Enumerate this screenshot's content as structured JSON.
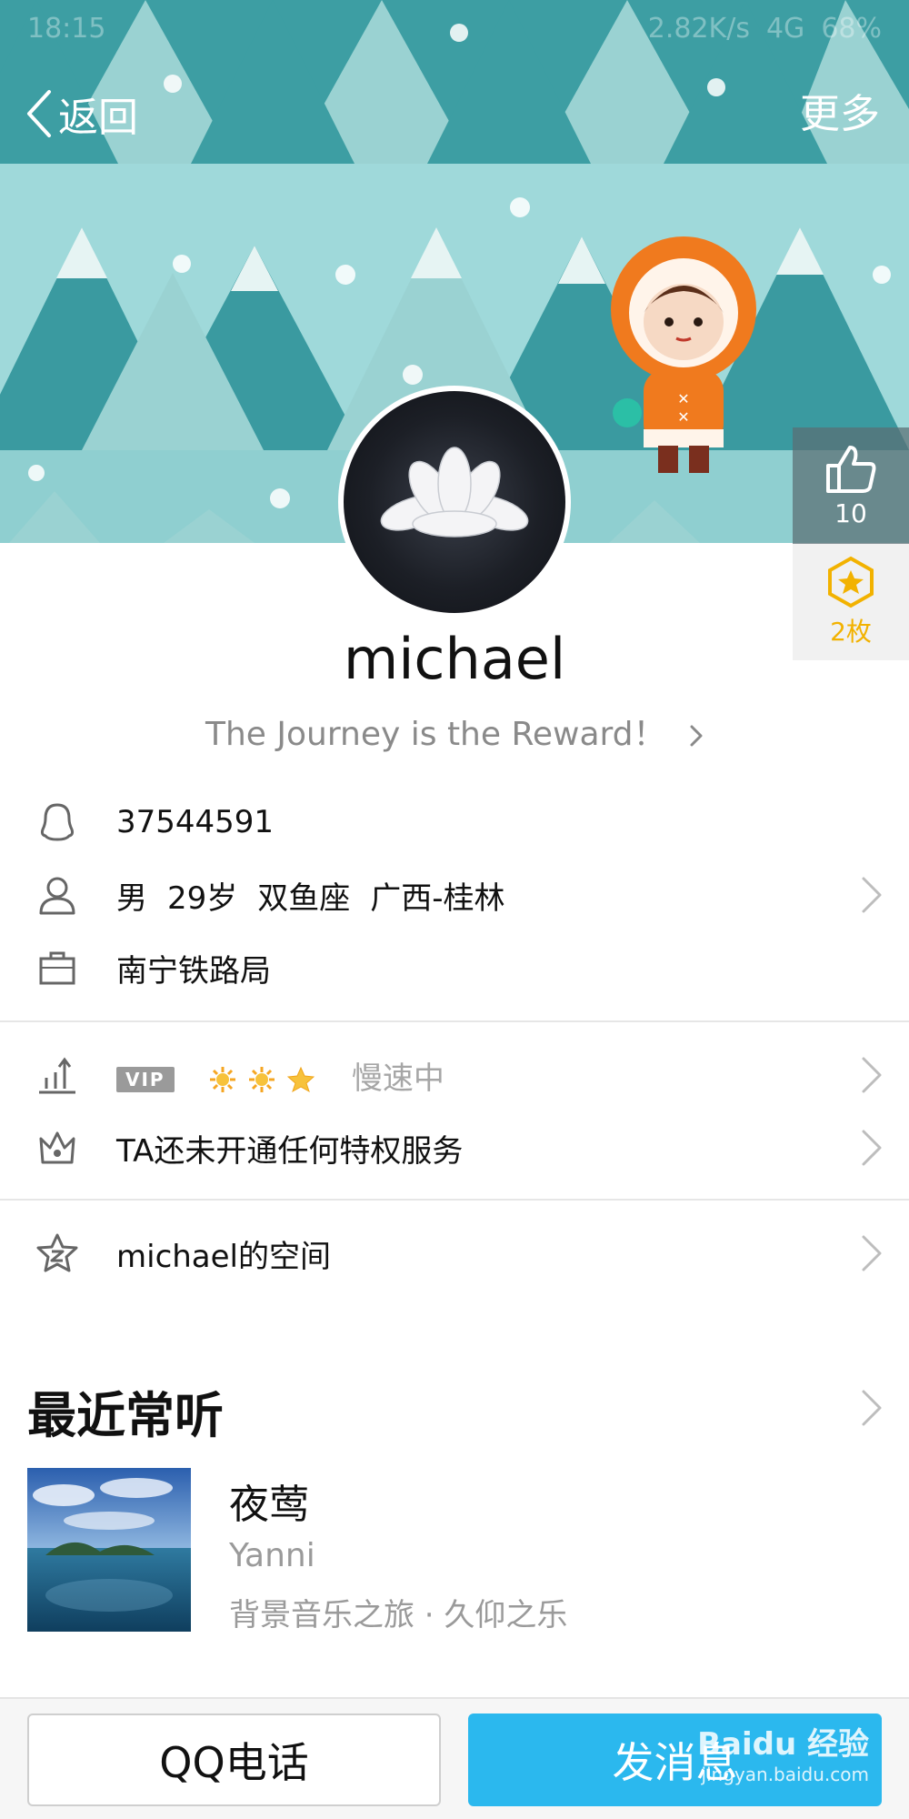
{
  "status_bar": {
    "time": "18:15",
    "speed": "2.82K/s",
    "network": "4G",
    "battery": "68%"
  },
  "nav": {
    "back_label": "返回",
    "more_label": "更多"
  },
  "likes": {
    "count": "10"
  },
  "badges": {
    "count": "2枚"
  },
  "profile": {
    "name": "michael",
    "signature": "The Journey is the Reward！"
  },
  "info": {
    "qq_number": "37544591",
    "gender": "男",
    "age": "29岁",
    "zodiac": "双鱼座",
    "location": "广西-桂林",
    "company": "南宁铁路局"
  },
  "level": {
    "vip_tag": "VIP",
    "speed_text": "慢速中"
  },
  "privilege": {
    "text": "TA还未开通任何特权服务"
  },
  "qzone": {
    "label": "michael的空间"
  },
  "recent": {
    "title": "最近常听",
    "song": {
      "title": "夜莺",
      "artist": "Yanni",
      "album": "背景音乐之旅 · 久仰之乐"
    }
  },
  "actions": {
    "call_label": "QQ电话",
    "message_label": "发消息"
  },
  "watermark": {
    "brand": "Baidu 经验",
    "url": "jingyan.baidu.com"
  },
  "colors": {
    "accent": "#2bb8ee",
    "badge_gold": "#f2b200",
    "sky": "#9fd9da",
    "tree_dark": "#3a9aa0",
    "tree_light": "#8fd0d1",
    "coat_orange": "#f07a1e"
  }
}
